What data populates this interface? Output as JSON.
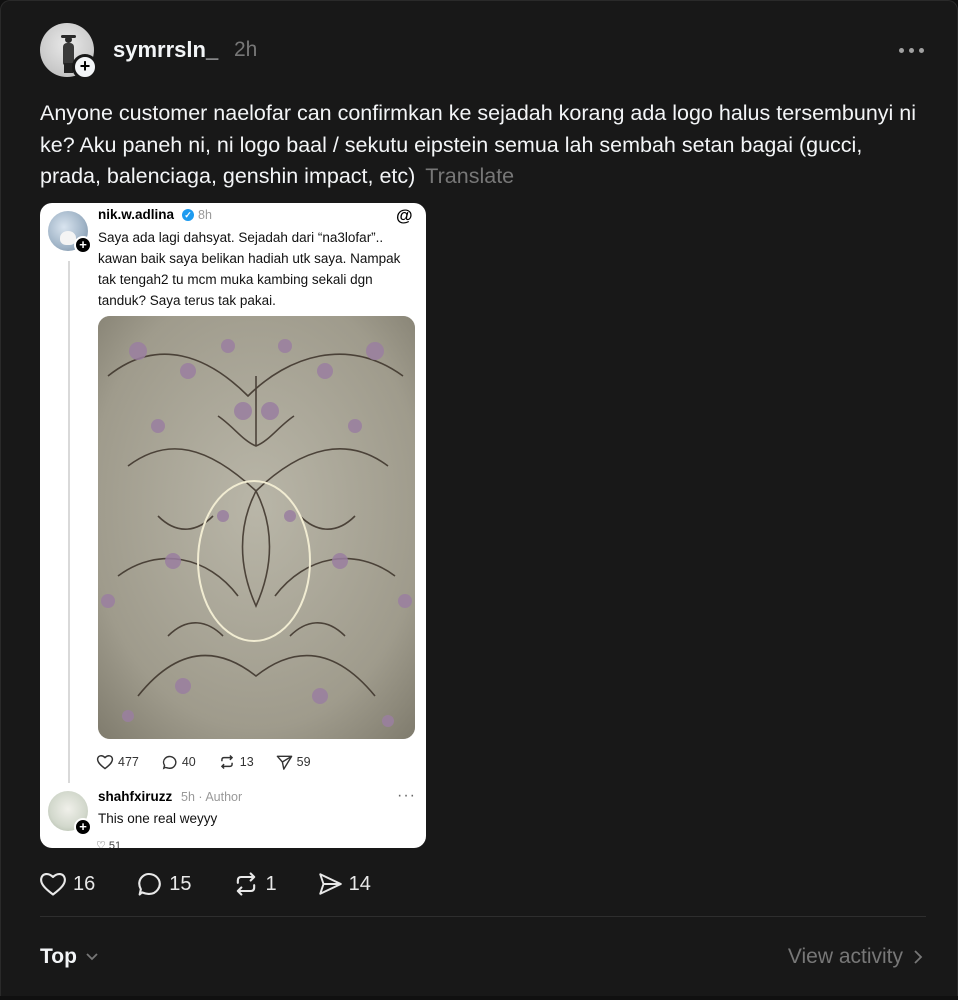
{
  "post": {
    "username": "symrrsln_",
    "time": "2h",
    "text": "Anyone customer naelofar can confirmkan ke sejadah korang ada logo halus tersembunyi ni ke? Aku paneh ni, ni logo baal / sekutu eipstein semua lah sembah setan bagai (gucci, prada, balenciaga, genshin impact, etc)",
    "translate_label": "Translate"
  },
  "embed": {
    "username": "nik.w.adlina",
    "time": "8h",
    "text": "Saya ada lagi dahsyat. Sejadah dari “na3lofar”.. kawan baik saya belikan hadiah utk saya. Nampak tak tengah2 tu mcm muka kambing sekali dgn tanduk? Saya terus tak pakai.",
    "likes": "477",
    "replies": "40",
    "reposts": "13",
    "shares": "59",
    "reply": {
      "username": "shahfxiruzz",
      "meta": "5h · Author",
      "text": "This one real weyyy",
      "likes_partial": "51"
    }
  },
  "actions": {
    "likes": "16",
    "replies": "15",
    "reposts": "1",
    "shares": "14"
  },
  "footer": {
    "sort_label": "Top",
    "view_activity_label": "View activity"
  },
  "colors": {
    "background": "#181818",
    "text": "#f3f5f7",
    "muted": "#777777",
    "verified": "#1d9bf0"
  }
}
